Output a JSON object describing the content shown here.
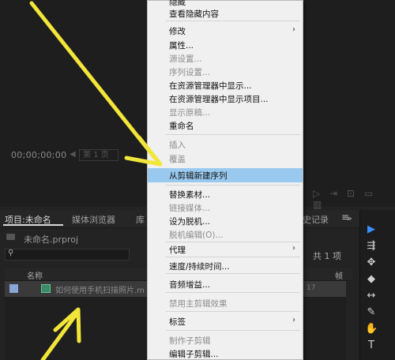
{
  "monitor": {
    "timecode": "00;00;00;00",
    "fit_label": "第 1 页",
    "fit_arrow": "◀",
    "transport_icons": [
      "▷",
      "⇥",
      "⊡",
      "▭",
      "▥"
    ]
  },
  "panel": {
    "tabs": {
      "project": "项目:未命名",
      "media_browser": "媒体浏览器",
      "libraries": "库",
      "history": "史记录"
    },
    "more": "≡",
    "project_file": "未命名.prproj",
    "items_count": "共 1 项",
    "columns": {
      "name": "名称",
      "fps": "帧"
    },
    "row": {
      "label": "如何使用手机扫描照片.m",
      "fps": "17"
    }
  },
  "tools": {
    "more_label": "»",
    "items": [
      "▶",
      "⇶",
      "✥",
      "◆",
      "↔",
      "✎",
      "✋",
      "T"
    ]
  },
  "context_menu": {
    "items": [
      {
        "label": "隐藏",
        "disabled": false
      },
      {
        "label": "查看隐藏内容",
        "disabled": false
      },
      {
        "label": "修改",
        "disabled": false,
        "submenu": true
      },
      {
        "label": "属性...",
        "disabled": false
      },
      {
        "label": "源设置...",
        "disabled": true
      },
      {
        "label": "序列设置...",
        "disabled": true
      },
      {
        "label": "在资源管理器中显示...",
        "disabled": false
      },
      {
        "label": "在资源管理器中显示项目...",
        "disabled": false
      },
      {
        "label": "显示原稿...",
        "disabled": true
      },
      {
        "label": "重命名",
        "disabled": false
      },
      {
        "label": "插入",
        "disabled": true
      },
      {
        "label": "覆盖",
        "disabled": true
      },
      {
        "label": "从剪辑新建序列",
        "disabled": false,
        "highlighted": true
      },
      {
        "label": "替换素材...",
        "disabled": false
      },
      {
        "label": "链接媒体...",
        "disabled": true
      },
      {
        "label": "设为脱机...",
        "disabled": false
      },
      {
        "label": "脱机编辑(O)...",
        "disabled": true
      },
      {
        "label": "代理",
        "disabled": false,
        "submenu": true
      },
      {
        "label": "速度/持续时间...",
        "disabled": false
      },
      {
        "label": "音频增益...",
        "disabled": false
      },
      {
        "label": "禁用主剪辑效果",
        "disabled": true
      },
      {
        "label": "标签",
        "disabled": false,
        "submenu": true
      },
      {
        "label": "制作子剪辑",
        "disabled": true
      },
      {
        "label": "编辑子剪辑...",
        "disabled": false
      }
    ],
    "submenu_arrow": "›",
    "highlight_color": "#99c9ef"
  },
  "colors": {
    "annotation_arrow": "#f2e63a",
    "tool_selected": "#3a8fff"
  }
}
